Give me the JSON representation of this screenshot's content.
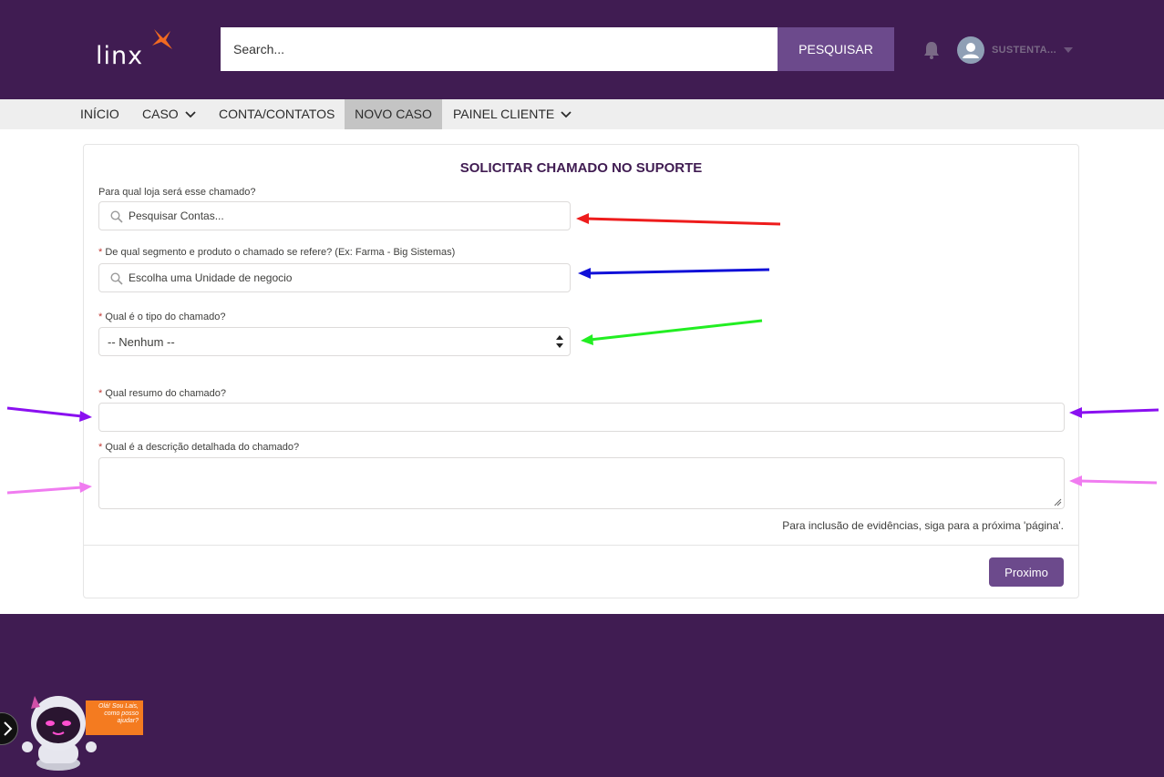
{
  "header": {
    "logo_text": "linx",
    "search_placeholder": "Search...",
    "search_button": "PESQUISAR",
    "user_name": "SUSTENTA..."
  },
  "nav": {
    "items": [
      {
        "label": "INÍCIO"
      },
      {
        "label": "CASO"
      },
      {
        "label": "CONTA/CONTATOS"
      },
      {
        "label": "NOVO CASO"
      },
      {
        "label": "PAINEL CLIENTE"
      }
    ]
  },
  "form": {
    "title": "SOLICITAR CHAMADO NO SUPORTE",
    "store_label": "Para qual loja será esse chamado?",
    "store_placeholder": "Pesquisar Contas...",
    "segment_label": "De qual segmento e produto o chamado se refere? (Ex: Farma - Big Sistemas)",
    "segment_placeholder": "Escolha uma Unidade de negocio",
    "type_label": "Qual é o tipo do chamado?",
    "type_selected": "-- Nenhum --",
    "summary_label": "Qual resumo do chamado?",
    "summary_value": "",
    "description_label": "Qual é a descrição detalhada do chamado?",
    "description_value": "",
    "required_marker": "*",
    "hint": "Para inclusão de evidências, siga para a próxima 'página'.",
    "next_button": "Proximo"
  },
  "chatbot": {
    "bubble_line1": "Olá! Sou Lais,",
    "bubble_line2": "como posso",
    "bubble_line3": "ajudar?"
  },
  "annotation_colors": {
    "red": "#ee1c1c",
    "blue": "#1010d8",
    "green": "#22ee22",
    "purple": "#8a10f0",
    "pink": "#f07cf0"
  },
  "colors": {
    "brand_purple": "#401c52",
    "button_purple": "#6c4a8c",
    "logo_orange": "#f26a21"
  }
}
